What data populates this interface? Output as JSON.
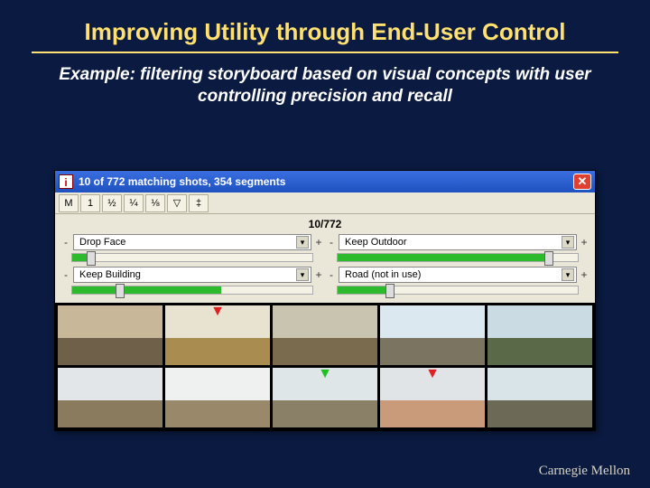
{
  "slide": {
    "title": "Improving Utility through End-User Control",
    "subtitle": "Example: filtering storyboard based on visual concepts with user controlling precision and recall"
  },
  "window": {
    "app_icon_letter": "i",
    "title": "10 of 772 matching shots, 354 segments"
  },
  "toolbar": {
    "b0": "M",
    "b1": "1",
    "b2": "½",
    "b3": "¼",
    "b4": "⅛",
    "b5": "▽",
    "b6": "‡"
  },
  "counter": "10/772",
  "filters": [
    {
      "label": "Drop Face",
      "minus": "-",
      "plus": "+",
      "fill": 8,
      "thumb": 6
    },
    {
      "label": "Keep Outdoor",
      "minus": "-",
      "plus": "+",
      "fill": 88,
      "thumb": 86
    },
    {
      "label": "Keep Building",
      "minus": "-",
      "plus": "+",
      "fill": 62,
      "thumb": 18
    },
    {
      "label": "Road (not in use)",
      "minus": "-",
      "plus": "+",
      "fill": 22,
      "thumb": 20
    }
  ],
  "shots": [
    {
      "sky": "#c9b79a",
      "ground": "#6f604a",
      "marker": ""
    },
    {
      "sky": "#e8e2d0",
      "ground": "#a88c50",
      "marker": "red"
    },
    {
      "sky": "#c8c4b0",
      "ground": "#7a6a4e",
      "marker": ""
    },
    {
      "sky": "#dbe8ef",
      "ground": "#7a7460",
      "marker": ""
    },
    {
      "sky": "#cadbe4",
      "ground": "#5a6a48",
      "marker": ""
    },
    {
      "sky": "#e2e6e8",
      "ground": "#8a7a5e",
      "marker": ""
    },
    {
      "sky": "#eef1f0",
      "ground": "#9a886a",
      "marker": ""
    },
    {
      "sky": "#dfe6e8",
      "ground": "#8a8068",
      "marker": "green"
    },
    {
      "sky": "#e0e4e6",
      "ground": "#c99b7a",
      "marker": "red"
    },
    {
      "sky": "#d8e4e8",
      "ground": "#6c6a56",
      "marker": ""
    }
  ],
  "brand": "Carnegie Mellon"
}
